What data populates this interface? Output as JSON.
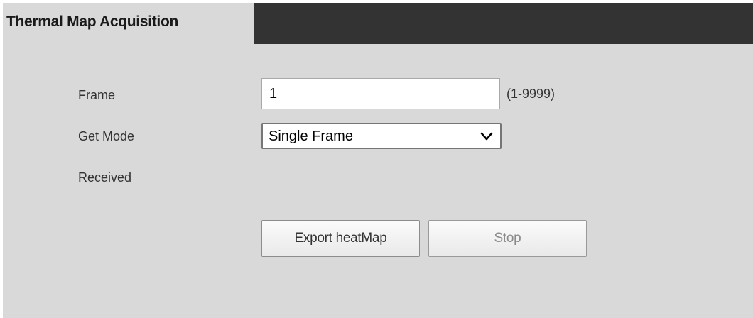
{
  "header": {
    "title": "Thermal Map Acquisition"
  },
  "form": {
    "frame": {
      "label": "Frame",
      "value": "1",
      "range_hint": "(1-9999)"
    },
    "get_mode": {
      "label": "Get Mode",
      "selected": "Single Frame"
    },
    "received": {
      "label": "Received"
    }
  },
  "actions": {
    "export_label": "Export heatMap",
    "stop_label": "Stop",
    "stop_enabled": false
  },
  "icons": {
    "select_arrow": "chevron-down-icon"
  },
  "colors": {
    "panel_background": "#d9d9d9",
    "title_bar_dark": "#333333",
    "disabled_text": "#8a8a8a"
  }
}
